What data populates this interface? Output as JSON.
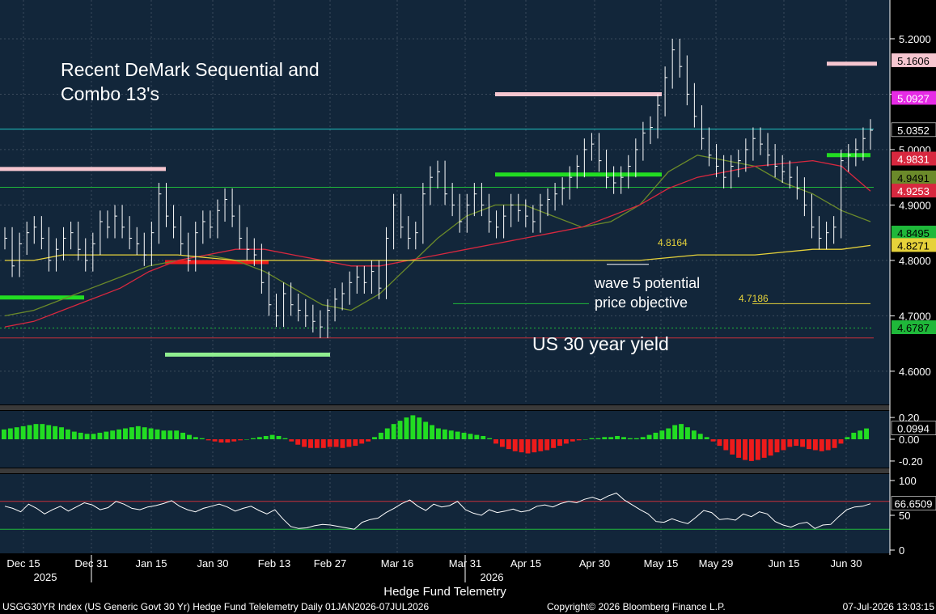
{
  "title_text": [
    "Recent DeMark Sequential and",
    "Combo 13's"
  ],
  "series_label": "US 30 year yield",
  "annotations": {
    "wave5": [
      "wave 5 potential",
      "price objective"
    ],
    "level_a": "4.8164",
    "level_b": "4.7186"
  },
  "x_label": "Hedge Fund Telemetry",
  "footer": {
    "left": "USGG30YR Index (US Generic Govt 30 Yr) Hedge Fund Telelemetry Daily 01JAN2026-07JUL2026",
    "center": "Copyright© 2026 Bloomberg Finance L.P.",
    "right": "07-Jul-2026 13:03:15"
  },
  "year_labels": [
    "2025",
    "2026"
  ],
  "colors": {
    "panel_bg": "#12263a",
    "price_bar": "#ffffff",
    "ma_yellow": "#e6d23a",
    "ma_red": "#d8283f",
    "ma_olive": "#6b8a2a",
    "pos_hist": "#22dd22",
    "neg_hist": "#ee1b1b",
    "rsi_line": "#ffffff",
    "rsi_high": "#c8303a",
    "rsi_low": "#1fb83a"
  },
  "chart_data": [
    {
      "type": "line",
      "name": "price",
      "x_ticks": [
        "Dec 15",
        "Dec 31",
        "Jan 15",
        "Jan 30",
        "Feb 13",
        "Feb 27",
        "Mar 16",
        "Mar 31",
        "Apr 15",
        "Apr 30",
        "May 15",
        "May 29",
        "Jun 15",
        "Jun 30"
      ],
      "y_ticks": [
        "4.6000",
        "4.7000",
        "4.8000",
        "4.9000",
        "5.0000",
        "5.1000",
        "5.2000"
      ],
      "ylim": [
        4.54,
        5.27
      ],
      "close": [
        4.84,
        4.79,
        4.83,
        4.85,
        4.86,
        4.84,
        4.8,
        4.82,
        4.84,
        4.85,
        4.82,
        4.8,
        4.83,
        4.87,
        4.86,
        4.88,
        4.86,
        4.84,
        4.83,
        4.81,
        4.85,
        4.92,
        4.88,
        4.86,
        4.83,
        4.8,
        4.85,
        4.87,
        4.86,
        4.89,
        4.91,
        4.88,
        4.84,
        4.82,
        4.81,
        4.76,
        4.72,
        4.7,
        4.74,
        4.72,
        4.71,
        4.7,
        4.69,
        4.68,
        4.71,
        4.73,
        4.74,
        4.76,
        4.77,
        4.76,
        4.78,
        4.75,
        4.84,
        4.9,
        4.86,
        4.84,
        4.85,
        4.92,
        4.95,
        4.96,
        4.92,
        4.9,
        4.87,
        4.9,
        4.92,
        4.9,
        4.87,
        4.86,
        4.88,
        4.9,
        4.89,
        4.88,
        4.87,
        4.9,
        4.91,
        4.92,
        4.93,
        4.95,
        4.97,
        5.0,
        5.01,
        4.98,
        4.95,
        4.94,
        4.95,
        4.97,
        5.0,
        5.03,
        5.04,
        5.08,
        5.13,
        5.18,
        5.15,
        5.1,
        5.06,
        5.02,
        4.99,
        4.97,
        4.95,
        4.97,
        4.98,
        5.0,
        5.02,
        5.01,
        4.99,
        4.97,
        4.96,
        4.95,
        4.93,
        4.9,
        4.86,
        4.84,
        4.85,
        4.86,
        4.98,
        4.99,
        5.0,
        5.02,
        5.035
      ],
      "series": [
        {
          "name": "",
          "values": [
            4.7,
            4.71,
            4.73,
            4.75,
            4.77,
            4.79,
            4.8,
            4.81,
            4.8,
            4.78,
            4.75,
            4.72,
            4.71,
            4.74,
            4.79,
            4.84,
            4.88,
            4.9,
            4.9,
            4.88,
            4.86,
            4.87,
            4.9,
            4.96,
            4.99,
            4.98,
            4.97,
            4.94,
            4.92,
            4.89,
            4.87
          ]
        },
        {
          "name": "",
          "values": [
            4.68,
            4.69,
            4.71,
            4.73,
            4.75,
            4.78,
            4.8,
            4.81,
            4.82,
            4.82,
            4.81,
            4.8,
            4.79,
            4.79,
            4.8,
            4.81,
            4.82,
            4.83,
            4.84,
            4.85,
            4.86,
            4.88,
            4.9,
            4.93,
            4.95,
            4.96,
            4.97,
            4.975,
            4.98,
            4.97,
            4.925
          ]
        },
        {
          "name": "",
          "values": [
            4.8,
            4.8,
            4.81,
            4.81,
            4.81,
            4.81,
            4.81,
            4.805,
            4.8,
            4.8,
            4.8,
            4.8,
            4.8,
            4.8,
            4.8,
            4.8,
            4.8,
            4.8,
            4.8,
            4.8,
            4.8,
            4.8,
            4.8,
            4.805,
            4.81,
            4.81,
            4.81,
            4.815,
            4.82,
            4.82,
            4.8271
          ]
        }
      ],
      "value_labels": [
        {
          "text": "5.1606",
          "value": 5.1606,
          "color": "#f6c6d0",
          "fg": "#000000"
        },
        {
          "text": "5.0927",
          "value": 5.0927,
          "color": "#e62be6",
          "fg": "#ffffff"
        },
        {
          "text": "5.0352",
          "value": 5.0352,
          "color": "#000000",
          "fg": "#ffffff"
        },
        {
          "text": "4.9831",
          "value": 4.9831,
          "color": "#d8283f",
          "fg": "#ffffff"
        },
        {
          "text": "4.9491",
          "value": 4.9491,
          "color": "#6b8a2a",
          "fg": "#000000"
        },
        {
          "text": "4.9253",
          "value": 4.9253,
          "color": "#d8283f",
          "fg": "#ffffff"
        },
        {
          "text": "4.8495",
          "value": 4.8495,
          "color": "#1fb83a",
          "fg": "#000000"
        },
        {
          "text": "4.8271",
          "value": 4.8271,
          "color": "#e6d23a",
          "fg": "#000000"
        },
        {
          "text": "4.6787",
          "value": 4.6787,
          "color": "#1fb83a",
          "fg": "#000000"
        }
      ]
    },
    {
      "type": "bar",
      "name": "oscillator",
      "y_ticks": [
        "0.20",
        "0.00",
        "-0.20"
      ],
      "ylim": [
        -0.26,
        0.26
      ],
      "values": [
        0.09,
        0.1,
        0.11,
        0.12,
        0.13,
        0.14,
        0.14,
        0.13,
        0.12,
        0.11,
        0.09,
        0.07,
        0.06,
        0.05,
        0.05,
        0.06,
        0.07,
        0.08,
        0.09,
        0.1,
        0.11,
        0.12,
        0.11,
        0.1,
        0.09,
        0.08,
        0.08,
        0.08,
        0.06,
        0.04,
        0.02,
        0.01,
        -0.01,
        -0.02,
        -0.03,
        -0.03,
        -0.02,
        -0.01,
        0.0,
        0.01,
        0.02,
        0.03,
        0.04,
        0.03,
        0.01,
        -0.02,
        -0.05,
        -0.07,
        -0.08,
        -0.08,
        -0.08,
        -0.07,
        -0.07,
        -0.08,
        -0.07,
        -0.06,
        -0.04,
        -0.02,
        0.02,
        0.06,
        0.1,
        0.14,
        0.17,
        0.2,
        0.22,
        0.2,
        0.16,
        0.13,
        0.1,
        0.09,
        0.08,
        0.07,
        0.06,
        0.05,
        0.04,
        0.03,
        0.01,
        -0.04,
        -0.07,
        -0.09,
        -0.11,
        -0.12,
        -0.13,
        -0.12,
        -0.11,
        -0.1,
        -0.08,
        -0.06,
        -0.04,
        -0.02,
        -0.01,
        0.0,
        0.01,
        0.01,
        0.02,
        0.02,
        0.03,
        0.02,
        0.01,
        0.01,
        0.02,
        0.04,
        0.06,
        0.08,
        0.1,
        0.13,
        0.14,
        0.11,
        0.08,
        0.05,
        0.02,
        -0.02,
        -0.06,
        -0.1,
        -0.14,
        -0.17,
        -0.19,
        -0.2,
        -0.19,
        -0.17,
        -0.15,
        -0.12,
        -0.1,
        -0.07,
        -0.06,
        -0.07,
        -0.09,
        -0.1,
        -0.11,
        -0.1,
        -0.08,
        -0.04,
        0.02,
        0.06,
        0.08,
        0.0994
      ],
      "value_label": "0.0994"
    },
    {
      "type": "line",
      "name": "rsi",
      "y_ticks": [
        "100",
        "50",
        "0"
      ],
      "ylim": [
        0,
        100
      ],
      "levels": [
        70,
        30
      ],
      "values": [
        63,
        60,
        55,
        66,
        60,
        52,
        58,
        63,
        56,
        62,
        68,
        65,
        58,
        61,
        70,
        66,
        60,
        58,
        62,
        64,
        67,
        71,
        63,
        58,
        55,
        60,
        63,
        66,
        62,
        56,
        60,
        63,
        57,
        52,
        58,
        45,
        34,
        31,
        32,
        35,
        37,
        36,
        34,
        32,
        30,
        40,
        44,
        46,
        54,
        60,
        67,
        72,
        63,
        57,
        66,
        62,
        64,
        70,
        58,
        53,
        50,
        58,
        54,
        56,
        59,
        55,
        57,
        63,
        65,
        62,
        67,
        70,
        68,
        73,
        76,
        72,
        78,
        82,
        72,
        65,
        58,
        52,
        41,
        40,
        45,
        41,
        38,
        47,
        57,
        54,
        44,
        45,
        43,
        52,
        48,
        55,
        52,
        41,
        36,
        33,
        38,
        40,
        31,
        36,
        37,
        48,
        58,
        62,
        63,
        66.6509
      ],
      "value_label": "66.6509"
    }
  ]
}
